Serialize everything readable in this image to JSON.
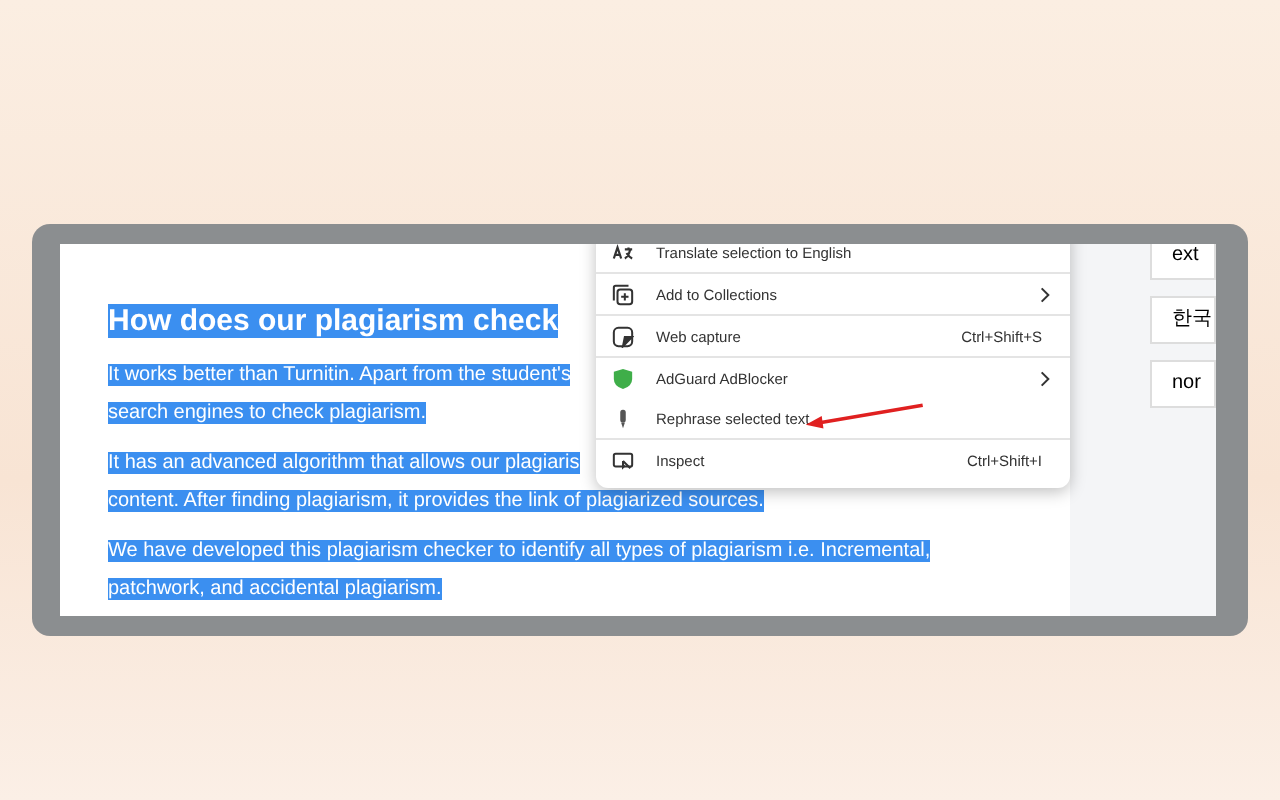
{
  "article": {
    "heading": "How does our plagiarism check",
    "paragraphs": [
      [
        "It works better than Turnitin. Apart from the student's",
        "search engines to check plagiarism."
      ],
      [
        "It has an advanced algorithm that allows our plagiaris",
        "content. After finding plagiarism, it provides the link of plagiarized sources."
      ],
      [
        "We have developed this plagiarism checker to identify all types of plagiarism i.e.  Incremental,",
        "patchwork, and accidental plagiarism."
      ]
    ]
  },
  "side_fields": [
    "ext",
    "한국",
    "nor"
  ],
  "context_menu": [
    {
      "label": "Translate selection to English",
      "submenu": false,
      "divider_after": true
    },
    {
      "label": "Add to Collections",
      "submenu": true,
      "divider_after": true
    },
    {
      "label": "Web capture",
      "shortcut": "Ctrl+Shift+S",
      "submenu": false,
      "divider_after": true
    },
    {
      "label": "AdGuard AdBlocker",
      "submenu": true,
      "divider_after": false
    },
    {
      "label": "Rephrase selected text",
      "submenu": false,
      "divider_after": true
    },
    {
      "label": "Inspect",
      "shortcut": "Ctrl+Shift+I",
      "submenu": false,
      "divider_after": false
    }
  ]
}
